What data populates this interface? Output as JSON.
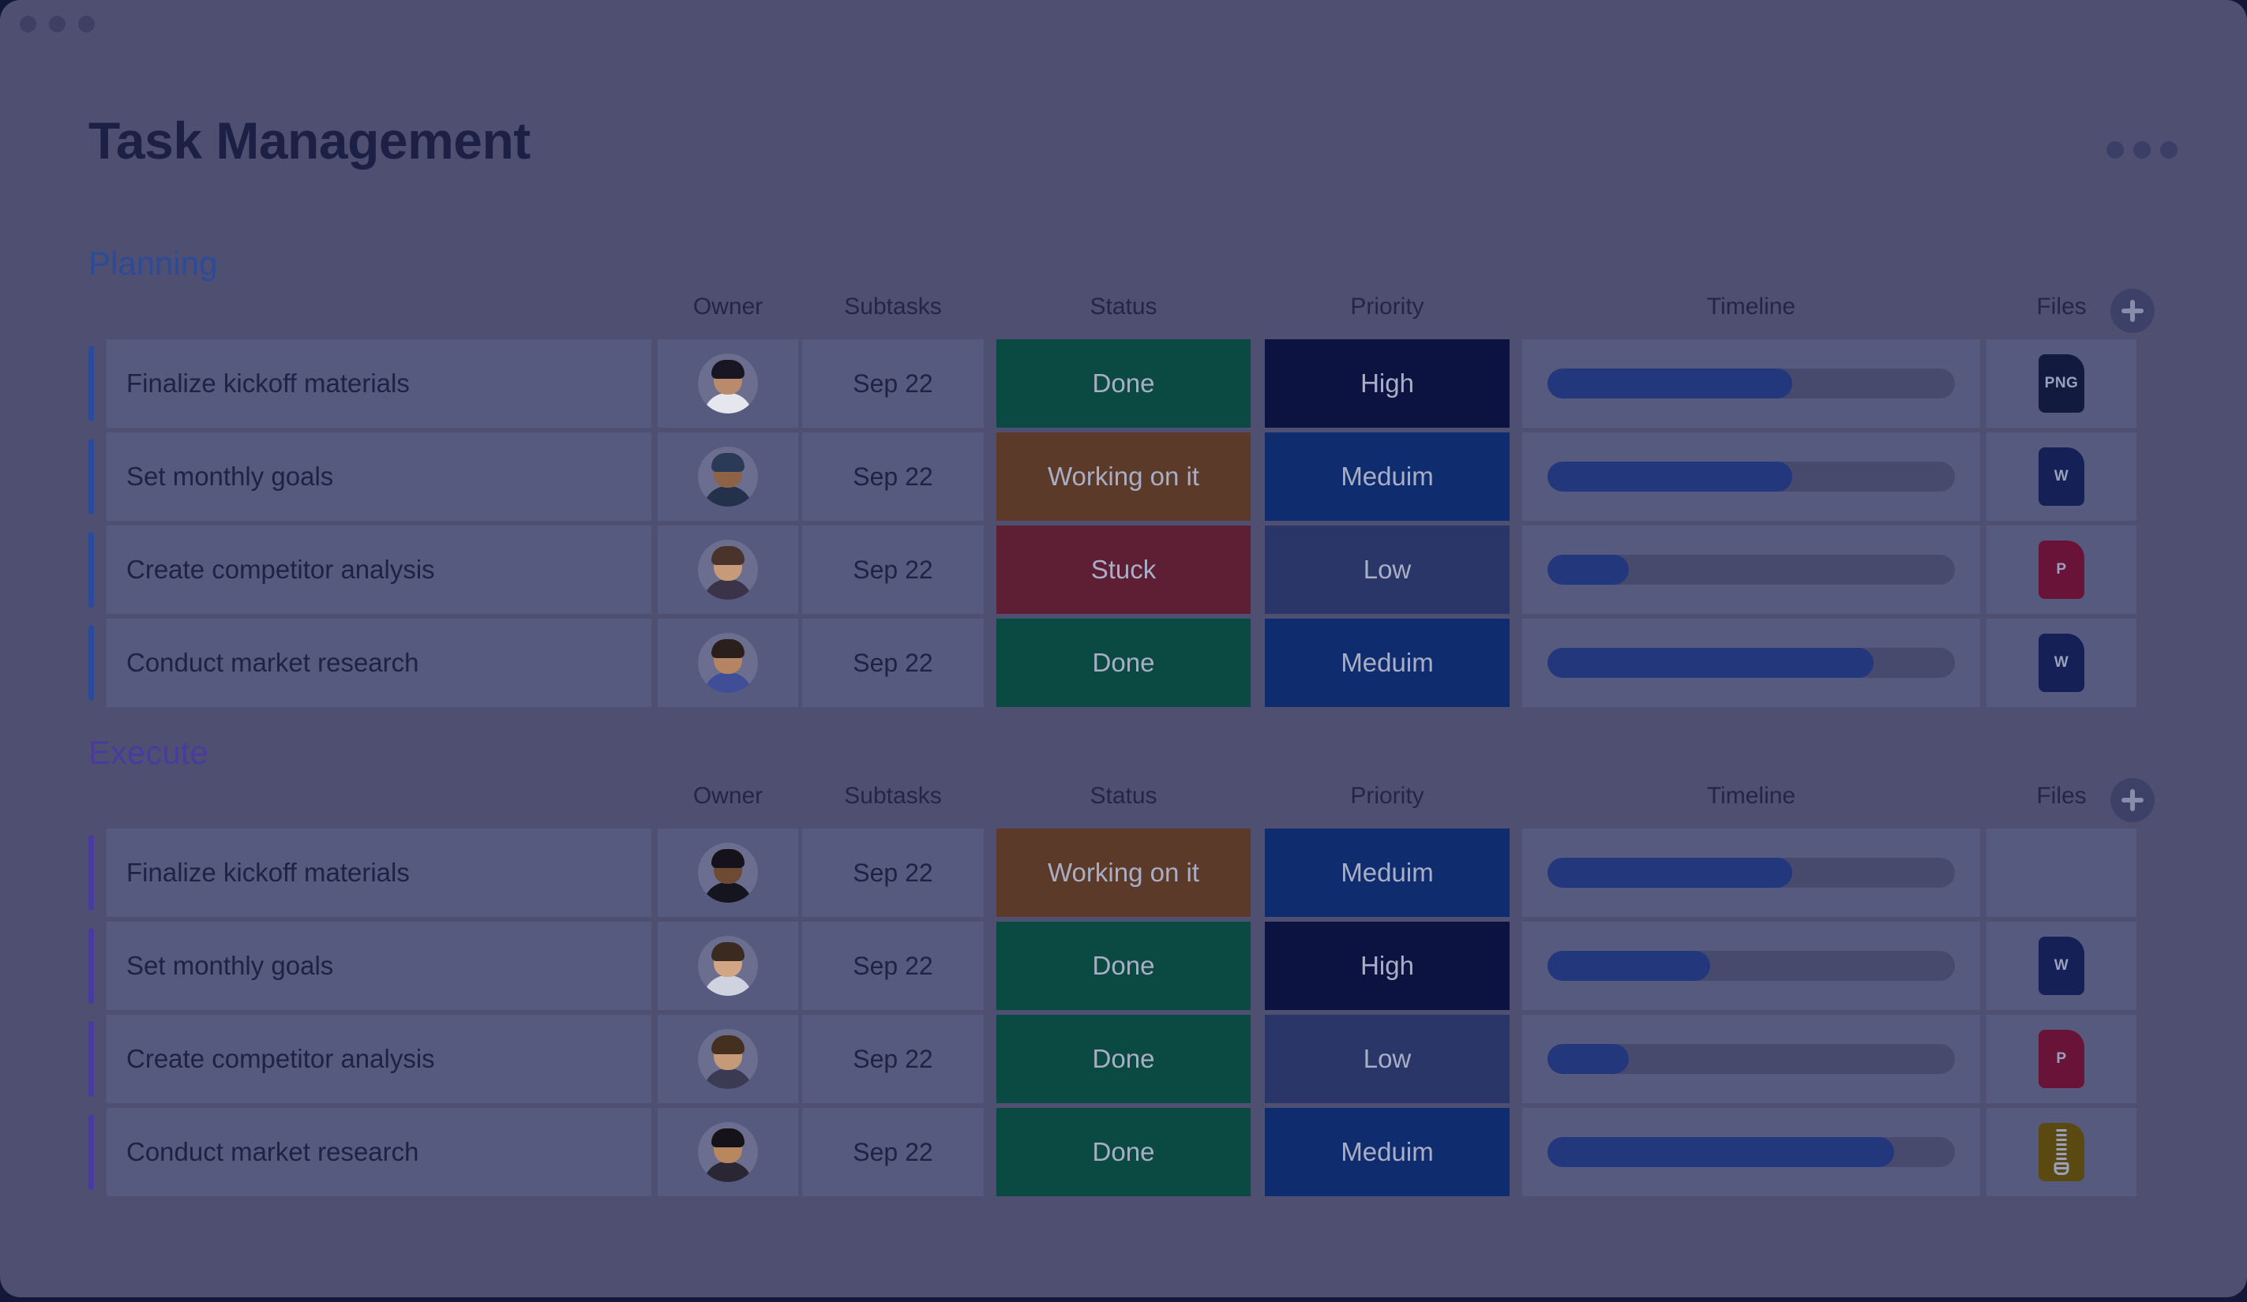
{
  "window": {
    "chrome_dots": [
      "close-dot",
      "minimize-dot",
      "maximize-dot"
    ]
  },
  "header": {
    "title": "Task Management",
    "overflow_label": "•••"
  },
  "columns": [
    "Owner",
    "Subtasks",
    "Status",
    "Priority",
    "Timeline",
    "Files"
  ],
  "add_column_label": "+",
  "colors": {
    "page_bg": "#4f5071",
    "outer_bg": "#141838",
    "cell_bg": "#565a7e",
    "planning_accent": "#2c4a9a",
    "execute_accent": "#4a3a9e",
    "status_done": "#0a4a42",
    "status_working": "#5c3a2a",
    "status_stuck": "#5e1f35",
    "priority_high": "#0d1340",
    "priority_medium": "#0f2c6e",
    "priority_low": "#2a3568",
    "timeline_fill": "#23377d",
    "timeline_track": "#474a6d"
  },
  "groups": [
    {
      "name": "Planning",
      "accent": "blue",
      "columns": [
        "Owner",
        "Subtasks",
        "Status",
        "Priority",
        "Timeline",
        "Files"
      ],
      "rows": [
        {
          "task": "Finalize kickoff materials",
          "owner": "avatar-male-1",
          "subtasks": "Sep 22",
          "status": "Done",
          "status_color": "#0a4a42",
          "priority": "High",
          "priority_color": "#0d1340",
          "timeline_percent": 60,
          "file": "PNG",
          "file_color": "#131a40"
        },
        {
          "task": "Set monthly goals",
          "owner": "avatar-male-2",
          "subtasks": "Sep 22",
          "status": "Working on it",
          "status_color": "#5c3a2a",
          "priority": "Meduim",
          "priority_color": "#0f2c6e",
          "timeline_percent": 60,
          "file": "W",
          "file_color": "#152057"
        },
        {
          "task": "Create competitor analysis",
          "owner": "avatar-female-1",
          "subtasks": "Sep 22",
          "status": "Stuck",
          "status_color": "#5e1f35",
          "priority": "Low",
          "priority_color": "#2a3568",
          "timeline_percent": 20,
          "file": "P",
          "file_color": "#6a1338"
        },
        {
          "task": "Conduct market research",
          "owner": "avatar-male-3",
          "subtasks": "Sep 22",
          "status": "Done",
          "status_color": "#0a4a42",
          "priority": "Meduim",
          "priority_color": "#0f2c6e",
          "timeline_percent": 80,
          "file": "W",
          "file_color": "#152057"
        }
      ]
    },
    {
      "name": "Execute",
      "accent": "purple",
      "columns": [
        "Owner",
        "Subtasks",
        "Status",
        "Priority",
        "Timeline",
        "Files"
      ],
      "rows": [
        {
          "task": "Finalize kickoff materials",
          "owner": "avatar-male-4",
          "subtasks": "Sep 22",
          "status": "Working on it",
          "status_color": "#5c3a2a",
          "priority": "Meduim",
          "priority_color": "#0f2c6e",
          "timeline_percent": 60,
          "file": "",
          "file_color": ""
        },
        {
          "task": "Set monthly goals",
          "owner": "avatar-female-2",
          "subtasks": "Sep 22",
          "status": "Done",
          "status_color": "#0a4a42",
          "priority": "High",
          "priority_color": "#0d1340",
          "timeline_percent": 40,
          "file": "W",
          "file_color": "#152057"
        },
        {
          "task": "Create competitor analysis",
          "owner": "avatar-female-3",
          "subtasks": "Sep 22",
          "status": "Done",
          "status_color": "#0a4a42",
          "priority": "Low",
          "priority_color": "#2a3568",
          "timeline_percent": 20,
          "file": "P",
          "file_color": "#6a1338"
        },
        {
          "task": "Conduct market research",
          "owner": "avatar-female-4",
          "subtasks": "Sep 22",
          "status": "Done",
          "status_color": "#0a4a42",
          "priority": "Meduim",
          "priority_color": "#0f2c6e",
          "timeline_percent": 85,
          "file": "ZIP",
          "file_color": "#5a4a12"
        }
      ]
    }
  ]
}
